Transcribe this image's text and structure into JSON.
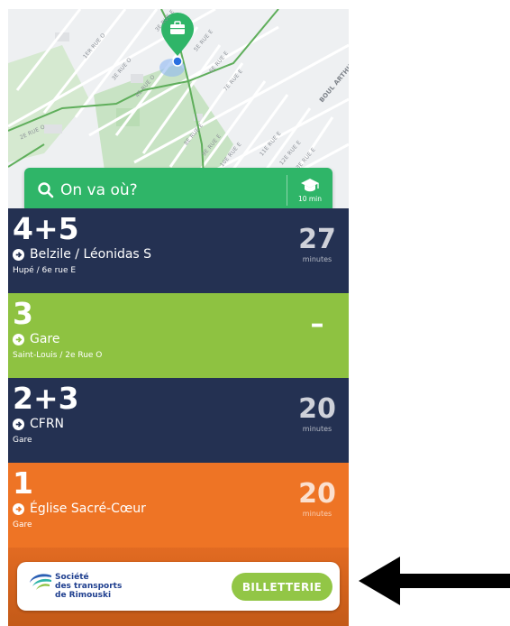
{
  "map": {
    "streets": [
      "1ER RUE O",
      "2E RUE O",
      "3E RUE O",
      "3E RUE E",
      "4E RUE O",
      "5E RUE E",
      "6E RUE E",
      "7E RUE E",
      "8E RUE E",
      "9E RUE E",
      "10E RUE E",
      "11E RUE E",
      "12E RUE E",
      "13E RUE E",
      "2E RUE O"
    ],
    "boulevard": "BOUL ARTHUR",
    "pin_icon": "briefcase-icon"
  },
  "search": {
    "placeholder": "On va où?",
    "grad_time": "10 min"
  },
  "routes": [
    {
      "number": "4+5",
      "destination": "Belzile / Léonidas S",
      "stop": "Hupé / 6e rue E",
      "minutes": "27",
      "unit": "minutes",
      "color": "#243152"
    },
    {
      "number": "3",
      "destination": "Gare",
      "stop": "Saint-Louis / 2e Rue O",
      "minutes": "–",
      "unit": "",
      "color": "#8ec241"
    },
    {
      "number": "2+3",
      "destination": "CFRN",
      "stop": "Gare",
      "minutes": "20",
      "unit": "minutes",
      "color": "#243152"
    },
    {
      "number": "1",
      "destination": "Église Sacré-Cœur",
      "stop": "Gare",
      "minutes": "20",
      "unit": "minutes",
      "color": "#ee7425"
    }
  ],
  "brand": {
    "line1": "Société",
    "line2": "des transports",
    "line3": "de Rimouski",
    "button": "BILLETTERIE"
  },
  "colors": {
    "accent_green": "#2fb568",
    "navy": "#243152",
    "lime": "#8ec241",
    "orange": "#ee7425"
  }
}
